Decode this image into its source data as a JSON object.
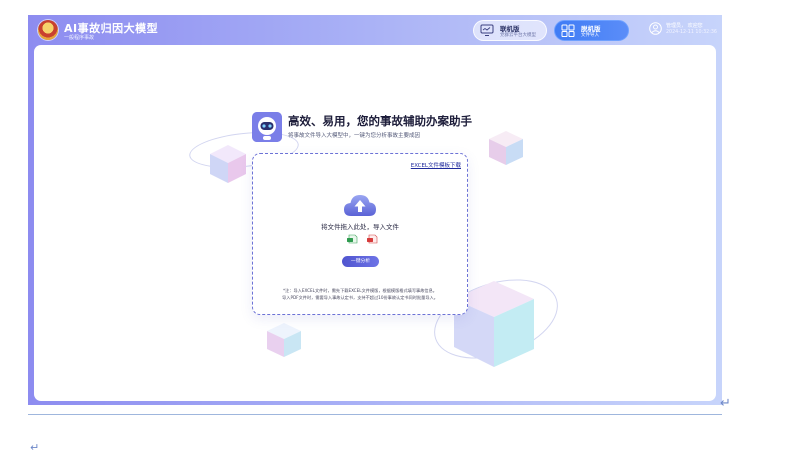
{
  "app": {
    "title": "AI事故归因大模型",
    "subtitle": "一般程序事故"
  },
  "modes": [
    {
      "name": "联机版",
      "desc": "党群云平台大模型",
      "icon": "monitor-icon",
      "active": false
    },
    {
      "name": "脱机版",
      "desc": "文件导入",
      "icon": "grid-icon",
      "active": true
    }
  ],
  "user": {
    "greeting": "管理员， 欢迎您",
    "datetime": "2024-12-11 10:32:36"
  },
  "hero": {
    "title": "高效、易用，您的事故辅助办案助手",
    "subtitle": "将事故文件导入大模型中，一键为您分析事故主要成因"
  },
  "upload": {
    "template_link": "EXCEL文件模板下载",
    "drop_text": "将文件拖入此处，导入文件",
    "file_types": [
      "excel-file-icon",
      "pdf-file-icon"
    ],
    "analyze_button": "一键分析",
    "note_line_1": "*注：导入EXCEL文件时，需先下载EXCEL文件模版，根据模版格式填写事故信息。",
    "note_line_2": "导入PDF文件时，需要导入事故认定书，支持不超过10份事故认定书同时批量导入。"
  },
  "colors": {
    "header_gradient_start": "#8d8cf0",
    "header_gradient_end": "#c7d4fb",
    "active_mode": "#3f7cf5",
    "primary_button": "#5055cf",
    "link": "#1f2a9c"
  }
}
